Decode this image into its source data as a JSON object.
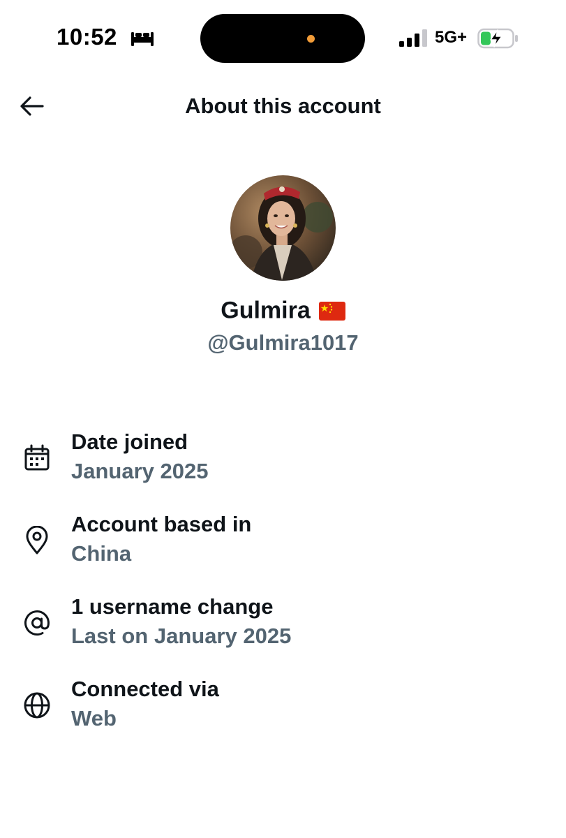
{
  "status_bar": {
    "time": "10:52",
    "network": "5G+",
    "icons": [
      "sleep-focus-icon",
      "cellular-signal-icon",
      "battery-charging-icon"
    ],
    "island_dot_color": "#f29c38"
  },
  "header": {
    "title": "About this account",
    "back_icon": "arrow-left-icon"
  },
  "profile": {
    "display_name": "Gulmira",
    "flag": "china-flag-icon",
    "username": "@Gulmira1017"
  },
  "info": {
    "date_joined": {
      "icon": "calendar-icon",
      "label": "Date joined",
      "value": "January 2025"
    },
    "based_in": {
      "icon": "location-pin-icon",
      "label": "Account based in",
      "value": "China"
    },
    "username_changes": {
      "icon": "at-sign-icon",
      "label": "1 username change",
      "value": "Last on January 2025"
    },
    "connected_via": {
      "icon": "globe-icon",
      "label": "Connected via",
      "value": "Web"
    }
  },
  "colors": {
    "primary_text": "#0f1419",
    "secondary_text": "#536471",
    "background": "#ffffff"
  }
}
